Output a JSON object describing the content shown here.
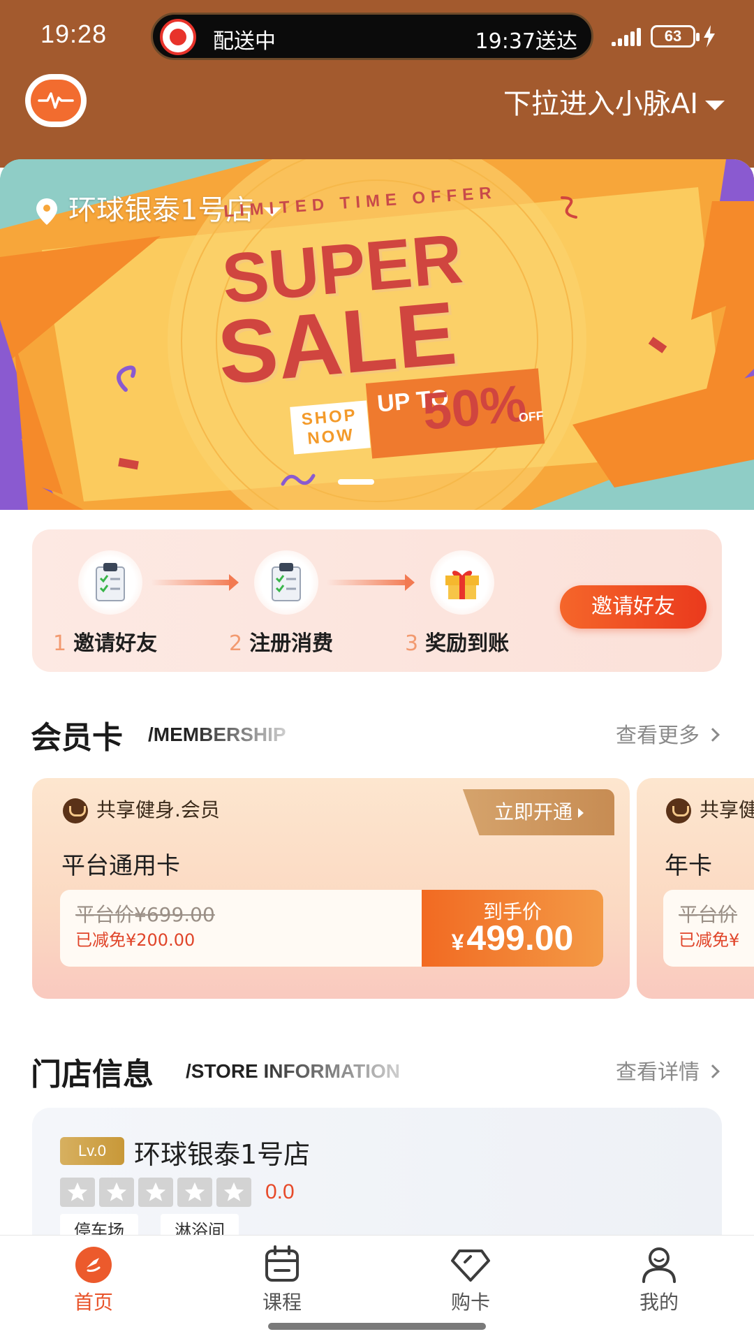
{
  "status_bar": {
    "time": "19:28",
    "delivery_status": "配送中",
    "delivery_eta": "19:37送达",
    "battery": "63"
  },
  "header": {
    "logo_icon": "pulse-chat-logo-icon",
    "ai_pull_label": "下拉进入小脉AI"
  },
  "banner": {
    "store_name": "环球银泰1号店",
    "limited": "LIMITED TIME OFFER",
    "super": "SUPER",
    "sale": "SALE",
    "shop_now": "SHOP NOW",
    "up_to": "UP TO",
    "percent": "50%",
    "off": "OFF",
    "slide_count": 1,
    "active_slide": 1
  },
  "invite": {
    "steps": [
      {
        "num": "1",
        "label": "邀请好友",
        "icon": "clipboard-check-icon"
      },
      {
        "num": "2",
        "label": "注册消费",
        "icon": "clipboard-check-icon"
      },
      {
        "num": "3",
        "label": "奖励到账",
        "icon": "gift-icon"
      }
    ],
    "button_label": "邀请好友"
  },
  "membership": {
    "title": "会员卡",
    "subtitle": "/MEMBERSHIP",
    "more_label": "查看更多",
    "cards": [
      {
        "tag": "共享健身.会员",
        "name": "平台通用卡",
        "open_label": "立即开通",
        "original_price": "平台价¥699.00",
        "saved": "已减免¥200.00",
        "final_label": "到手价",
        "final_currency": "¥",
        "final_price": "499.00"
      },
      {
        "tag": "共享健",
        "name": "年卡",
        "original_price": "平台价",
        "saved": "已减免¥"
      }
    ]
  },
  "store": {
    "title": "门店信息",
    "subtitle": "/STORE INFORMATION",
    "more_label": "查看详情",
    "level": "Lv.0",
    "name": "环球银泰1号店",
    "rating": "0.0",
    "stars_filled": 0,
    "stars_total": 5,
    "amenities": [
      "停车场",
      "淋浴间"
    ]
  },
  "tabbar": {
    "tabs": [
      {
        "label": "首页",
        "icon": "home-icon",
        "active": true
      },
      {
        "label": "课程",
        "icon": "calendar-icon",
        "active": false
      },
      {
        "label": "购卡",
        "icon": "diamond-tag-icon",
        "active": false
      },
      {
        "label": "我的",
        "icon": "user-icon",
        "active": false
      }
    ]
  },
  "colors": {
    "header_bg": "#a35a2e",
    "accent": "#e8532a",
    "invite_button": "#ea3a1d"
  }
}
